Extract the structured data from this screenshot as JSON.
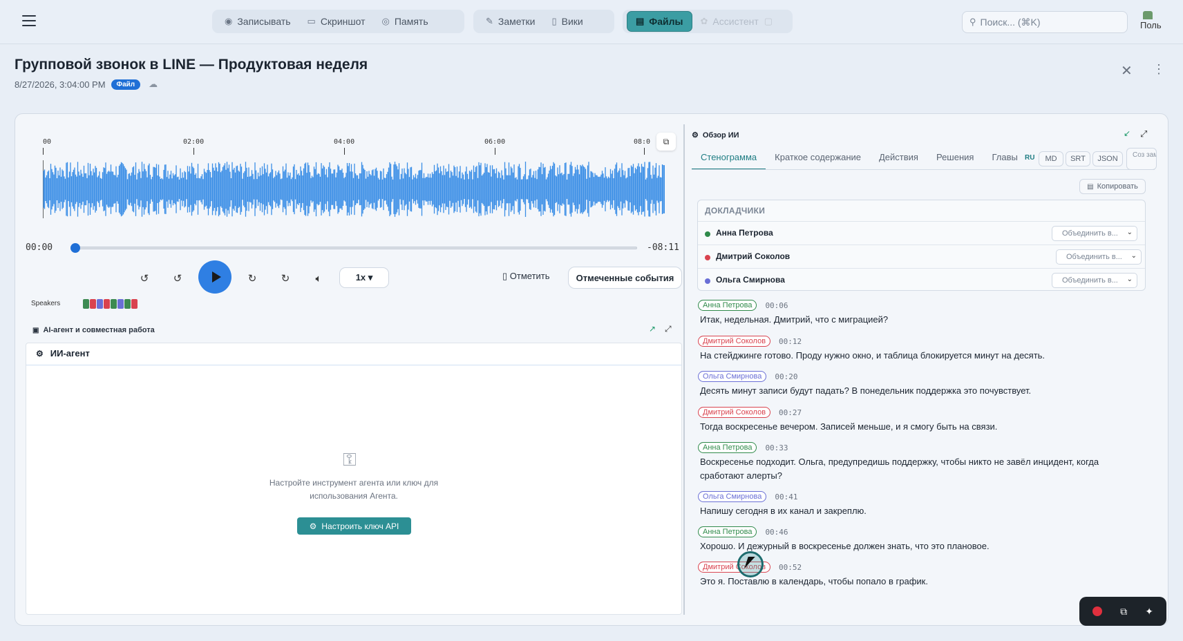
{
  "nav": {
    "record": "Записывать",
    "screenshot": "Скриншот",
    "memory": "Память",
    "notes": "Заметки",
    "wiki": "Вики",
    "files": "Файлы",
    "assistant": "Ассистент",
    "search_placeholder": "Поиск... (⌘K)",
    "avatar_alt": "Поль"
  },
  "header": {
    "title": "Групповой звонок в LINE — Продуктовая неделя",
    "datetime": "8/27/2026, 3:04:00 PM",
    "badge": "Файл"
  },
  "player": {
    "ticks": [
      "00",
      "02:00",
      "04:00",
      "06:00",
      "08:0"
    ],
    "current_time": "00:00",
    "remaining": "-08:11",
    "progress": 0,
    "speed": "1x ▾",
    "mark_label": "Отметить",
    "events_label": "Отмеченные события",
    "speakers_label": "Speakers",
    "speaker_colors": [
      "#3d8a52",
      "#d9434f",
      "#6a6fd6",
      "#d9434f",
      "#3d8a52",
      "#6a6fd6",
      "#3d8a52",
      "#d9434f"
    ],
    "wave_color": "#3a8ee6"
  },
  "agent": {
    "section_title": "AI-агент и совместная работа",
    "panel_title": "ИИ-агент",
    "message": "Настройте инструмент агента или ключ для использования Агента.",
    "button": "Настроить ключ API"
  },
  "ai": {
    "title": "Обзор ИИ",
    "tabs": [
      "Стенограмма",
      "Краткое содержание",
      "Действия",
      "Решения",
      "Главы"
    ],
    "lang": "RU",
    "formats": [
      "MD",
      "SRT",
      "JSON"
    ],
    "create": "Соз зам",
    "copy": "Копировать",
    "speakers_heading": "ДОКЛАДЧИКИ",
    "merge_placeholder": "Объединить в...",
    "speakers": [
      {
        "name": "Анна Петрова",
        "color": "#2f8a4a"
      },
      {
        "name": "Дмитрий Соколов",
        "color": "#d9434f"
      },
      {
        "name": "Ольга Смирнова",
        "color": "#6a6fd6"
      }
    ],
    "transcript": [
      {
        "speaker": "Анна Петрова",
        "time": "00:06",
        "text": "Итак, недельная. Дмитрий, что с миграцией?"
      },
      {
        "speaker": "Дмитрий Соколов",
        "time": "00:12",
        "text": "На стейджинге готово. Проду нужно окно, и таблица блокируется минут на десять."
      },
      {
        "speaker": "Ольга Смирнова",
        "time": "00:20",
        "text": "Десять минут записи будут падать? В понедельник поддержка это почувствует."
      },
      {
        "speaker": "Дмитрий Соколов",
        "time": "00:27",
        "text": "Тогда воскресенье вечером. Записей меньше, и я смогу быть на связи."
      },
      {
        "speaker": "Анна Петрова",
        "time": "00:33",
        "text": "Воскресенье подходит. Ольга, предупредишь поддержку, чтобы никто не завёл инцидент, когда сработают алерты?"
      },
      {
        "speaker": "Ольга Смирнова",
        "time": "00:41",
        "text": "Напишу сегодня в их канал и закреплю."
      },
      {
        "speaker": "Анна Петрова",
        "time": "00:46",
        "text": "Хорошо. И дежурный в воскресенье должен знать, что это плановое."
      },
      {
        "speaker": "Дмитрий Соколов",
        "time": "00:52",
        "text": "Это я. Поставлю в календарь, чтобы попало в график."
      }
    ]
  }
}
